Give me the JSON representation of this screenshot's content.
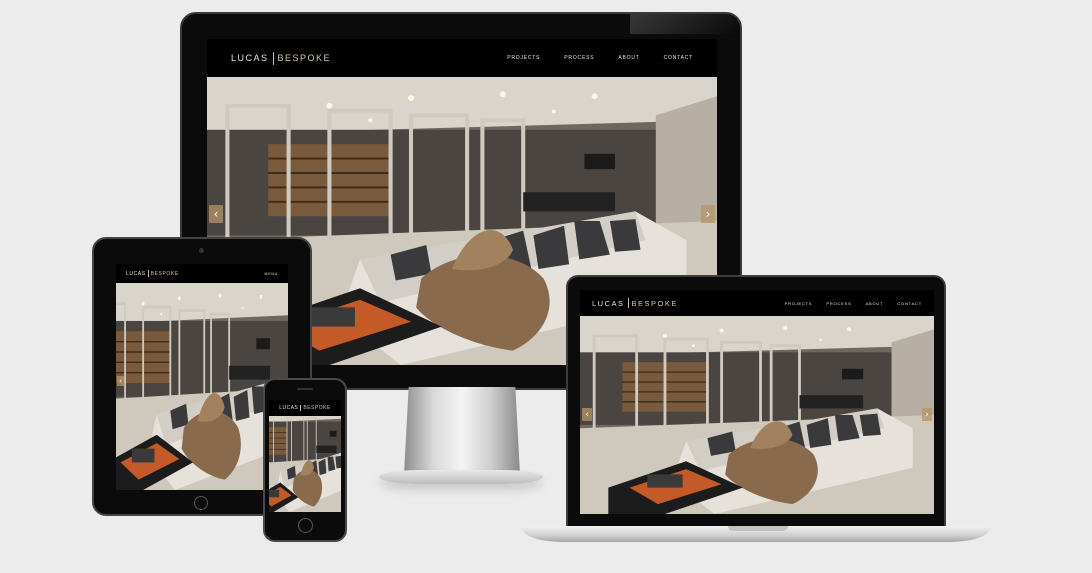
{
  "site": {
    "logo_left": "LUCAS",
    "logo_right": "BESPOKE",
    "nav": [
      "PROJECTS",
      "PROCESS",
      "ABOUT",
      "CONTACT"
    ],
    "tablet_menu_label": "MENU",
    "prev_arrow": "‹",
    "next_arrow": "›"
  },
  "colors": {
    "background": "#ececec",
    "bezel": "#0b0b0b",
    "header": "#000000",
    "accent": "#d6c6ad",
    "arrow": "#b4966a",
    "sofa_throw": "#8a6a4c",
    "table_accent": "#e0652a"
  },
  "devices": [
    "desktop-monitor",
    "laptop",
    "tablet",
    "phone"
  ],
  "icons": {
    "prev": "chevron-left-icon",
    "next": "chevron-right-icon",
    "home": "home-button-icon"
  }
}
